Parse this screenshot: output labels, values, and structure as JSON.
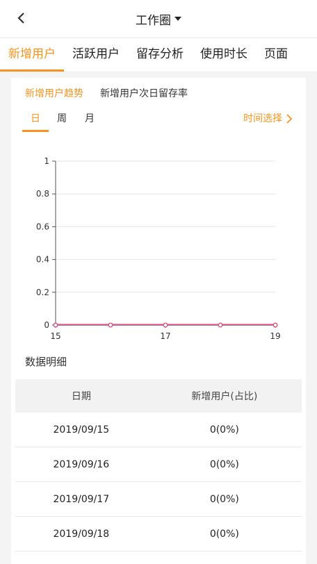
{
  "navbar": {
    "title": "工作圈"
  },
  "tabs": [
    {
      "label": "新增用户",
      "active": true
    },
    {
      "label": "活跃用户",
      "active": false
    },
    {
      "label": "留存分析",
      "active": false
    },
    {
      "label": "使用时长",
      "active": false
    },
    {
      "label": "页面",
      "active": false
    }
  ],
  "subtabs": [
    {
      "label": "新增用户趋势",
      "active": true
    },
    {
      "label": "新增用户次日留存率",
      "active": false
    }
  ],
  "periods": [
    {
      "label": "日",
      "active": true
    },
    {
      "label": "周",
      "active": false
    },
    {
      "label": "月",
      "active": false
    }
  ],
  "time_select": {
    "label": "时间选择"
  },
  "colors": {
    "accent": "#f7941d",
    "line_blue": "#5aa9f0",
    "line_red": "#e5527a"
  },
  "chart_data": {
    "type": "line",
    "x": [
      15,
      16,
      17,
      18,
      19
    ],
    "xticks": [
      "15",
      "17",
      "19"
    ],
    "yticks": [
      "1",
      "0.8",
      "0.6",
      "0.4",
      "0.2",
      "0"
    ],
    "ylim": [
      0,
      1
    ],
    "grid": true,
    "series": [
      {
        "values": [
          0,
          0,
          0,
          0,
          0
        ],
        "color": "#5aa9f0"
      },
      {
        "values": [
          0,
          0,
          0,
          0,
          0
        ],
        "color": "#e5527a"
      }
    ]
  },
  "table_section": {
    "title": "数据明细"
  },
  "table": {
    "headers": [
      "日期",
      "新增用户(占比)"
    ],
    "rows": [
      [
        "2019/09/15",
        "0(0%)"
      ],
      [
        "2019/09/16",
        "0(0%)"
      ],
      [
        "2019/09/17",
        "0(0%)"
      ],
      [
        "2019/09/18",
        "0(0%)"
      ]
    ]
  }
}
